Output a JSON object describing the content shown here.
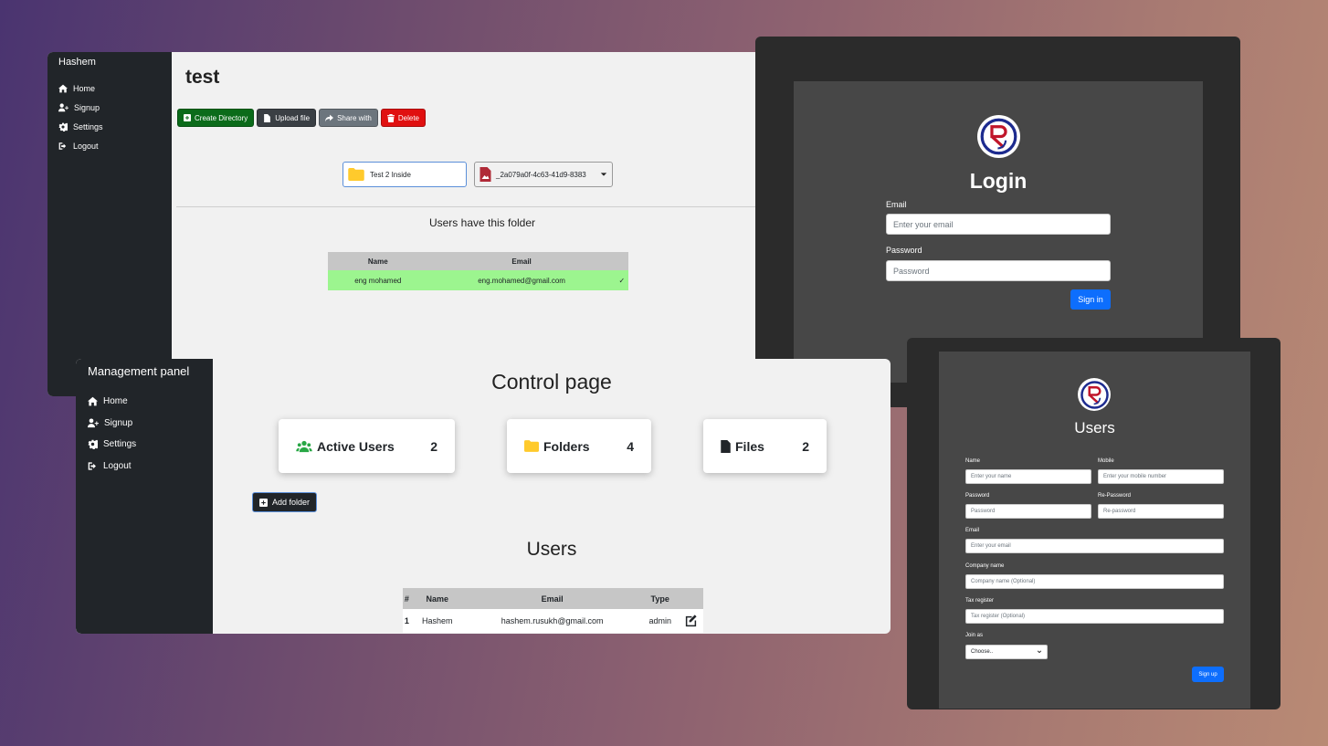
{
  "file_window": {
    "sidebar": {
      "title": "Hashem",
      "items": [
        {
          "label": "Home",
          "icon": "home-icon"
        },
        {
          "label": "Signup",
          "icon": "user-plus-icon"
        },
        {
          "label": "Settings",
          "icon": "gear-icon"
        },
        {
          "label": "Logout",
          "icon": "logout-icon"
        }
      ]
    },
    "folder_title": "test",
    "toolbar": {
      "create_directory": "Create Directory",
      "upload_file": "Upload file",
      "share_with": "Share with",
      "delete": "Delete"
    },
    "directory_item": "Test 2 Inside",
    "file_item": "_2a079a0f-4c63-41d9-8383",
    "users_heading": "Users have this folder",
    "table": {
      "columns": [
        "Name",
        "Email"
      ],
      "rows": [
        {
          "name": "eng mohamed",
          "email": "eng.mohamed@gmail.com",
          "check": "✓"
        }
      ]
    }
  },
  "login_window": {
    "title": "Login",
    "email_label": "Email",
    "email_placeholder": "Enter your email",
    "password_label": "Password",
    "password_placeholder": "Password",
    "submit": "Sign in"
  },
  "control_window": {
    "sidebar": {
      "title": "Management panel",
      "items": [
        {
          "label": "Home",
          "icon": "home-icon"
        },
        {
          "label": "Signup",
          "icon": "user-plus-icon"
        },
        {
          "label": "Settings",
          "icon": "gear-icon"
        },
        {
          "label": "Logout",
          "icon": "logout-icon"
        }
      ]
    },
    "title": "Control page",
    "stats": [
      {
        "label": "Active Users",
        "value": "2",
        "icon": "users-icon",
        "color": "#28a745"
      },
      {
        "label": "Folders",
        "value": "4",
        "icon": "folder-icon",
        "color": "#ffca2c"
      },
      {
        "label": "Files",
        "value": "2",
        "icon": "file-icon",
        "color": "#212529"
      }
    ],
    "add_folder": "Add folder",
    "users_heading": "Users",
    "table": {
      "columns": [
        "#",
        "Name",
        "Email",
        "Type"
      ],
      "rows": [
        {
          "num": "1",
          "name": "Hashem",
          "email": "hashem.rusukh@gmail.com",
          "type": "admin"
        }
      ]
    }
  },
  "signup_window": {
    "title": "Users",
    "fields": {
      "name_label": "Name",
      "name_placeholder": "Enter your name",
      "mobile_label": "Mobile",
      "mobile_placeholder": "Enter your mobile number",
      "password_label": "Password",
      "password_placeholder": "Password",
      "repassword_label": "Re-Password",
      "repassword_placeholder": "Re-password",
      "email_label": "Email",
      "email_placeholder": "Enter your email",
      "company_label": "Company name",
      "company_placeholder": "Company name (Optional)",
      "tax_label": "Tax register",
      "tax_placeholder": "Tax register (Optional)",
      "join_label": "Join as",
      "join_value": "Choose.."
    },
    "submit": "Sign up"
  },
  "colors": {
    "primary": "#0d6efd",
    "success": "#0b6b1a",
    "danger": "#e01010",
    "sidebar": "#212529",
    "row_highlight": "#9cf58f"
  }
}
